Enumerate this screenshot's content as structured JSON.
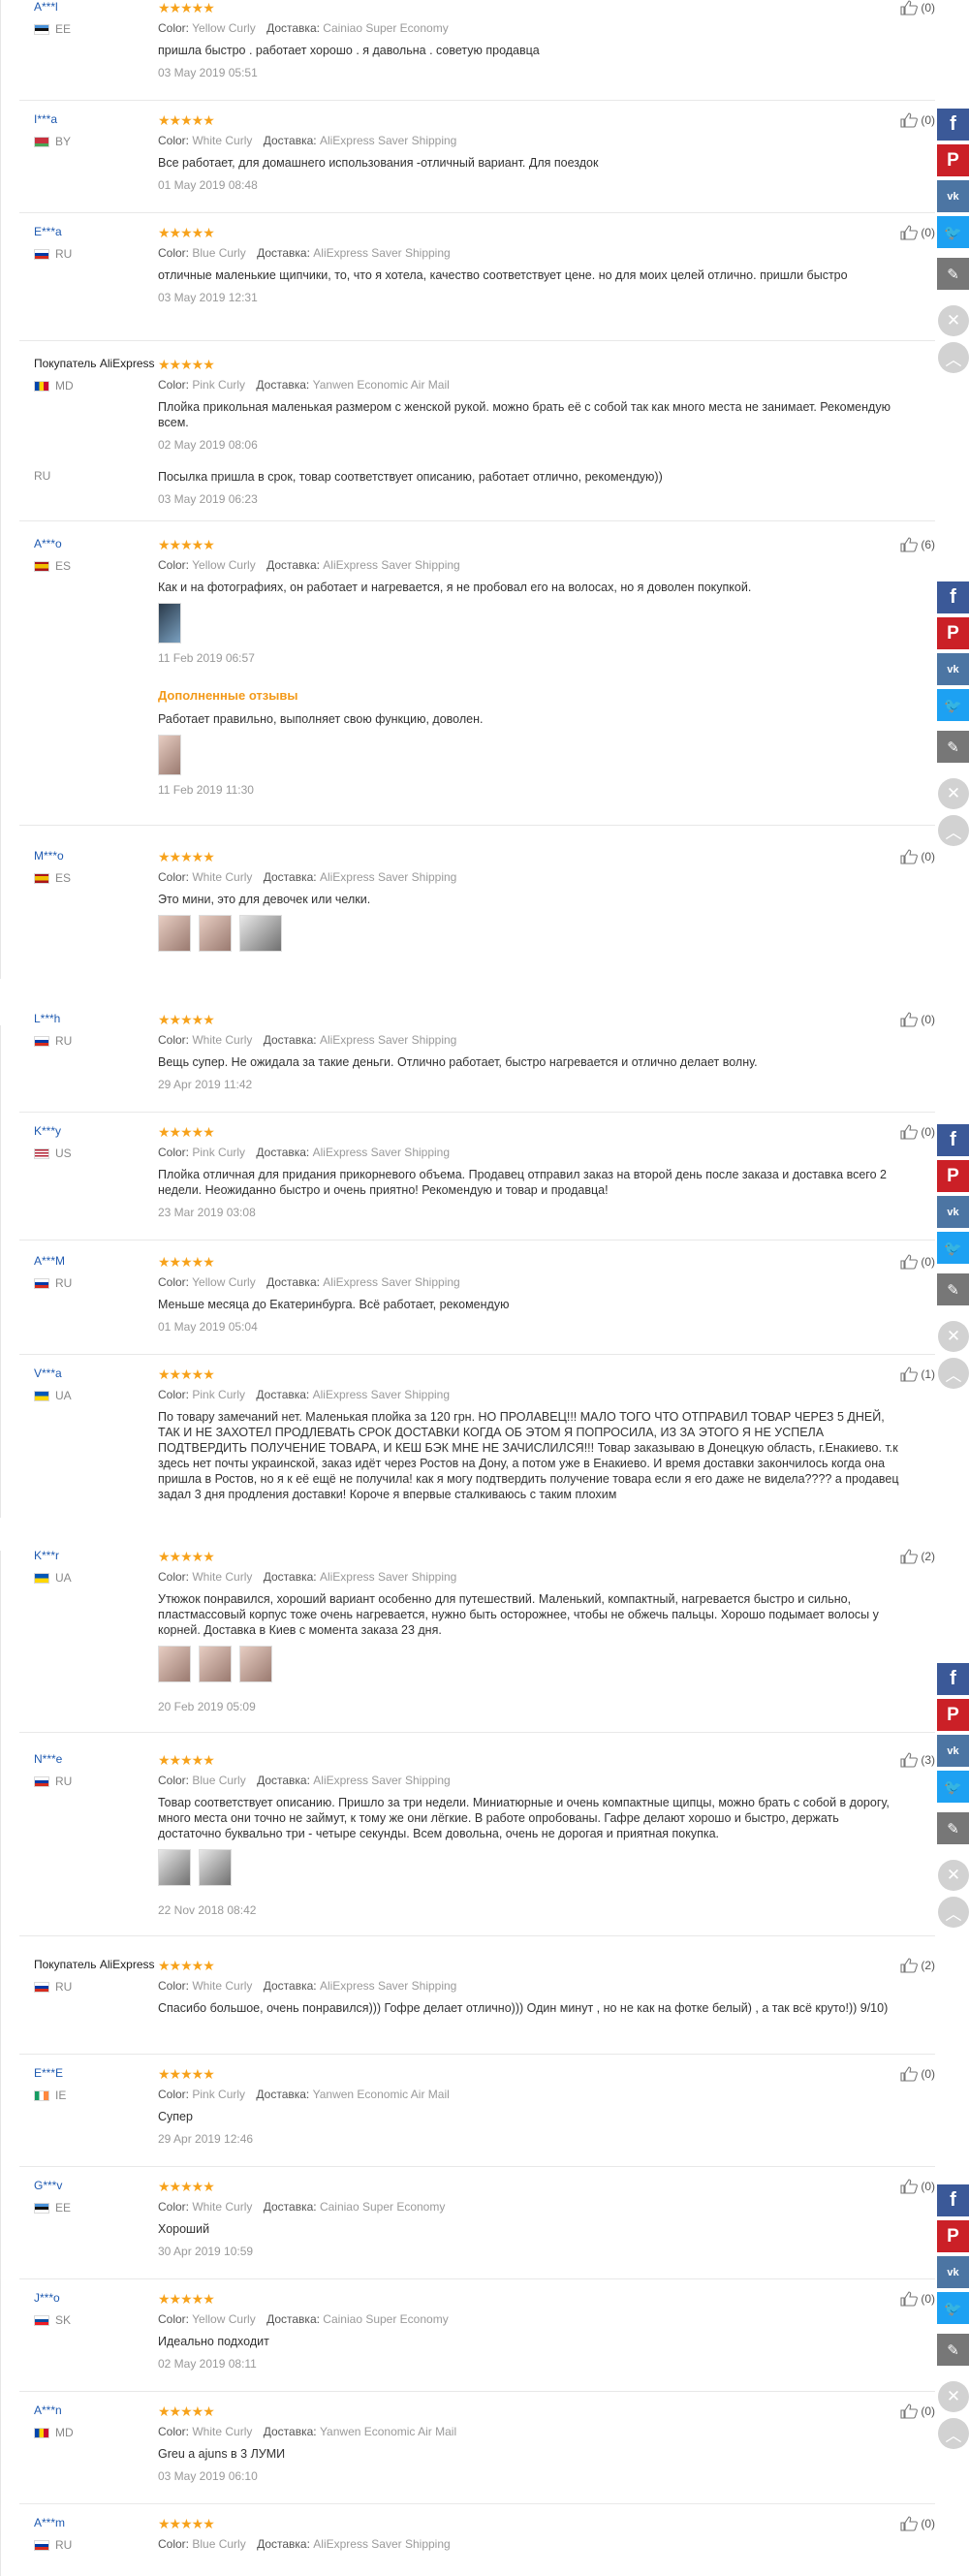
{
  "labels": {
    "color": "Color:",
    "delivery": "Доставка:",
    "additional": "Дополненные отзывы"
  },
  "reviews": [
    {
      "user": "A***l",
      "country": "EE",
      "stars": "★★★★★",
      "color": "Yellow Curly",
      "delivery": "Cainiao Super Economy",
      "text": "пришла быстро . работает хорошо . я давольна . советую продавца",
      "date": "03 May 2019 05:51",
      "likes": "(0)"
    },
    {
      "user": "I***a",
      "country": "BY",
      "stars": "★★★★★",
      "color": "White Curly",
      "delivery": "AliExpress Saver Shipping",
      "text": "Все работает, для домашнего использования -отличный вариант. Для поездок",
      "date": "01 May 2019 08:48",
      "likes": "(0)"
    },
    {
      "user": "E***a",
      "country": "RU",
      "stars": "★★★★★",
      "color": "Blue Curly",
      "delivery": "AliExpress Saver Shipping",
      "text": "отличные маленькие щипчики, то, что я хотела, качество соответствует цене. но для моих целей отлично. пришли быстро",
      "date": "03 May 2019 12:31",
      "likes": "(0)"
    },
    {
      "user": "Покупатель AliExpress",
      "country": "MD",
      "stars": "★★★★★",
      "color": "Pink Curly",
      "delivery": "Yanwen Economic Air Mail",
      "text": "Плойка прикольная маленькая размером с женской рукой. можно брать её с собой так как много места не занимает. Рекомендую всем.",
      "date": "02 May 2019 08:06"
    },
    {
      "country": "RU",
      "text": "Посылка пришла в срок, товар соответствует описанию, работает отлично, рекомендую))",
      "date": "03 May 2019 06:23"
    },
    {
      "user": "A***o",
      "country": "ES",
      "stars": "★★★★★",
      "color": "Yellow Curly",
      "delivery": "AliExpress Saver Shipping",
      "text": "Как и на фотографиях, он работает и нагревается, я не пробовал его на волосах, но я доволен покупкой.",
      "date": "11 Feb 2019 06:57",
      "likes": "(6)",
      "addl_text": "Работает правильно, выполняет свою функцию, доволен.",
      "addl_date": "11 Feb 2019 11:30"
    },
    {
      "user": "M***o",
      "country": "ES",
      "stars": "★★★★★",
      "color": "White Curly",
      "delivery": "AliExpress Saver Shipping",
      "text": "Это мини, это для девочек или челки.",
      "likes": "(0)"
    },
    {
      "user": "L***h",
      "country": "RU",
      "stars": "★★★★★",
      "color": "White Curly",
      "delivery": "AliExpress Saver Shipping",
      "text": "Вещь супер. Не ожидала за такие деньги. Отлично работает, быстро нагревается и отлично делает волну.",
      "date": "29 Apr 2019 11:42",
      "likes": "(0)"
    },
    {
      "user": "K***y",
      "country": "US",
      "stars": "★★★★★",
      "color": "Pink Curly",
      "delivery": "AliExpress Saver Shipping",
      "text": "Плойка отличная для придания прикорневого объема. Продавец отправил заказ на второй день после заказа и доставка всего 2 недели. Неожиданно быстро и очень приятно! Рекомендую и товар и продавца!",
      "date": "23 Mar 2019 03:08",
      "likes": "(0)"
    },
    {
      "user": "A***M",
      "country": "RU",
      "stars": "★★★★★",
      "color": "Yellow Curly",
      "delivery": "AliExpress Saver Shipping",
      "text": "Меньше месяца до Екатеринбурга. Всё работает, рекомендую",
      "date": "01 May 2019 05:04",
      "likes": "(0)"
    },
    {
      "user": "V***a",
      "country": "UA",
      "stars": "★★★★★",
      "color": "Pink Curly",
      "delivery": "AliExpress Saver Shipping",
      "text": "По товару замечаний нет. Маленькая плойка за 120 грн. НО ПРОЛАВЕЦ!!! МАЛО ТОГО ЧТО ОТПРАВИЛ ТОВАР ЧЕРЕЗ 5 ДНЕЙ, ТАК И НЕ ЗАХОТЕЛ ПРОДЛЕВАТЬ СРОК ДОСТАВКИ КОГДА ОБ ЭТОМ Я ПОПРОСИЛА, ИЗ ЗА ЭТОГО Я НЕ УСПЕЛА ПОДТВЕРДИТЬ ПОЛУЧЕНИЕ ТОВАРА, И КЕШ БЭК МНЕ НЕ ЗАЧИСЛИЛСЯ!!! Товар заказываю в Донецкую область, г.Енакиево. т.к здесь нет почты украинской, заказ идёт через Ростов на Дону, а потом уже в Енакиево. И время доставки закончилось когда она пришла в Ростов, но я к её ещё не получила! как я могу подтвердить получение товара если я его даже не видела???? а продавец задал 3 дня продления доставки! Короче я впервые сталкиваюсь с таким плохим",
      "likes": "(1)"
    },
    {
      "user": "K***r",
      "country": "UA",
      "stars": "★★★★★",
      "color": "White Curly",
      "delivery": "AliExpress Saver Shipping",
      "text": "Утюжок понравился, хороший вариант особенно для путешествий. Маленький, компактный, нагревается быстро и сильно, пластмассовый корпус тоже очень нагревается, нужно быть осторожнее, чтобы не обжечь пальцы. Хорошо подымает волосы у корней. Доставка в Киев с момента заказа 23 дня.",
      "date": "20 Feb 2019 05:09",
      "likes": "(2)"
    },
    {
      "user": "N***e",
      "country": "RU",
      "stars": "★★★★★",
      "color": "Blue Curly",
      "delivery": "AliExpress Saver Shipping",
      "text": "Товар соответствует описанию. Пришло за три недели. Миниатюрные и очень компактные щипцы, можно брать с собой в дорогу, много места они точно не займут, к тому же они лёгкие. В работе опробованы. Гафре делают хорошо и быстро, держать достаточно буквально три - четыре секунды. Всем довольна, очень не дорогая и приятная покупка.",
      "date": "22 Nov 2018 08:42",
      "likes": "(3)"
    },
    {
      "user": "Покупатель AliExpress",
      "country": "RU",
      "stars": "★★★★★",
      "color": "White Curly",
      "delivery": "AliExpress Saver Shipping",
      "text": "Спасибо большое, очень понравился))) Гофре делает отлично))) Один минут , но не как на фотке белый) , а так всё круто!)) 9/10)",
      "likes": "(2)"
    },
    {
      "user": "E***E",
      "country": "IE",
      "stars": "★★★★★",
      "color": "Pink Curly",
      "delivery": "Yanwen Economic Air Mail",
      "text": "Супер",
      "date": "29 Apr 2019 12:46",
      "likes": "(0)"
    },
    {
      "user": "G***v",
      "country": "EE",
      "stars": "★★★★★",
      "color": "White Curly",
      "delivery": "Cainiao Super Economy",
      "text": "Хороший",
      "date": "30 Apr 2019 10:59",
      "likes": "(0)"
    },
    {
      "user": "J***o",
      "country": "SK",
      "stars": "★★★★★",
      "color": "Yellow Curly",
      "delivery": "Cainiao Super Economy",
      "text": "Идеально подходит",
      "date": "02 May 2019 08:11",
      "likes": "(0)"
    },
    {
      "user": "A***n",
      "country": "MD",
      "stars": "★★★★★",
      "color": "White Curly",
      "delivery": "Yanwen Economic Air Mail",
      "text": "Greu a ajuns в 3 ЛУМИ",
      "date": "03 May 2019 06:10",
      "likes": "(0)"
    },
    {
      "user": "A***m",
      "country": "RU",
      "stars": "★★★★★",
      "color": "Blue Curly",
      "delivery": "AliExpress Saver Shipping",
      "likes": "(0)"
    }
  ],
  "share": {
    "facebook": "f",
    "pinterest": "P",
    "vk": "vk",
    "twitter": "🐦",
    "edit": "✎",
    "close": "✕",
    "up": "︿"
  }
}
